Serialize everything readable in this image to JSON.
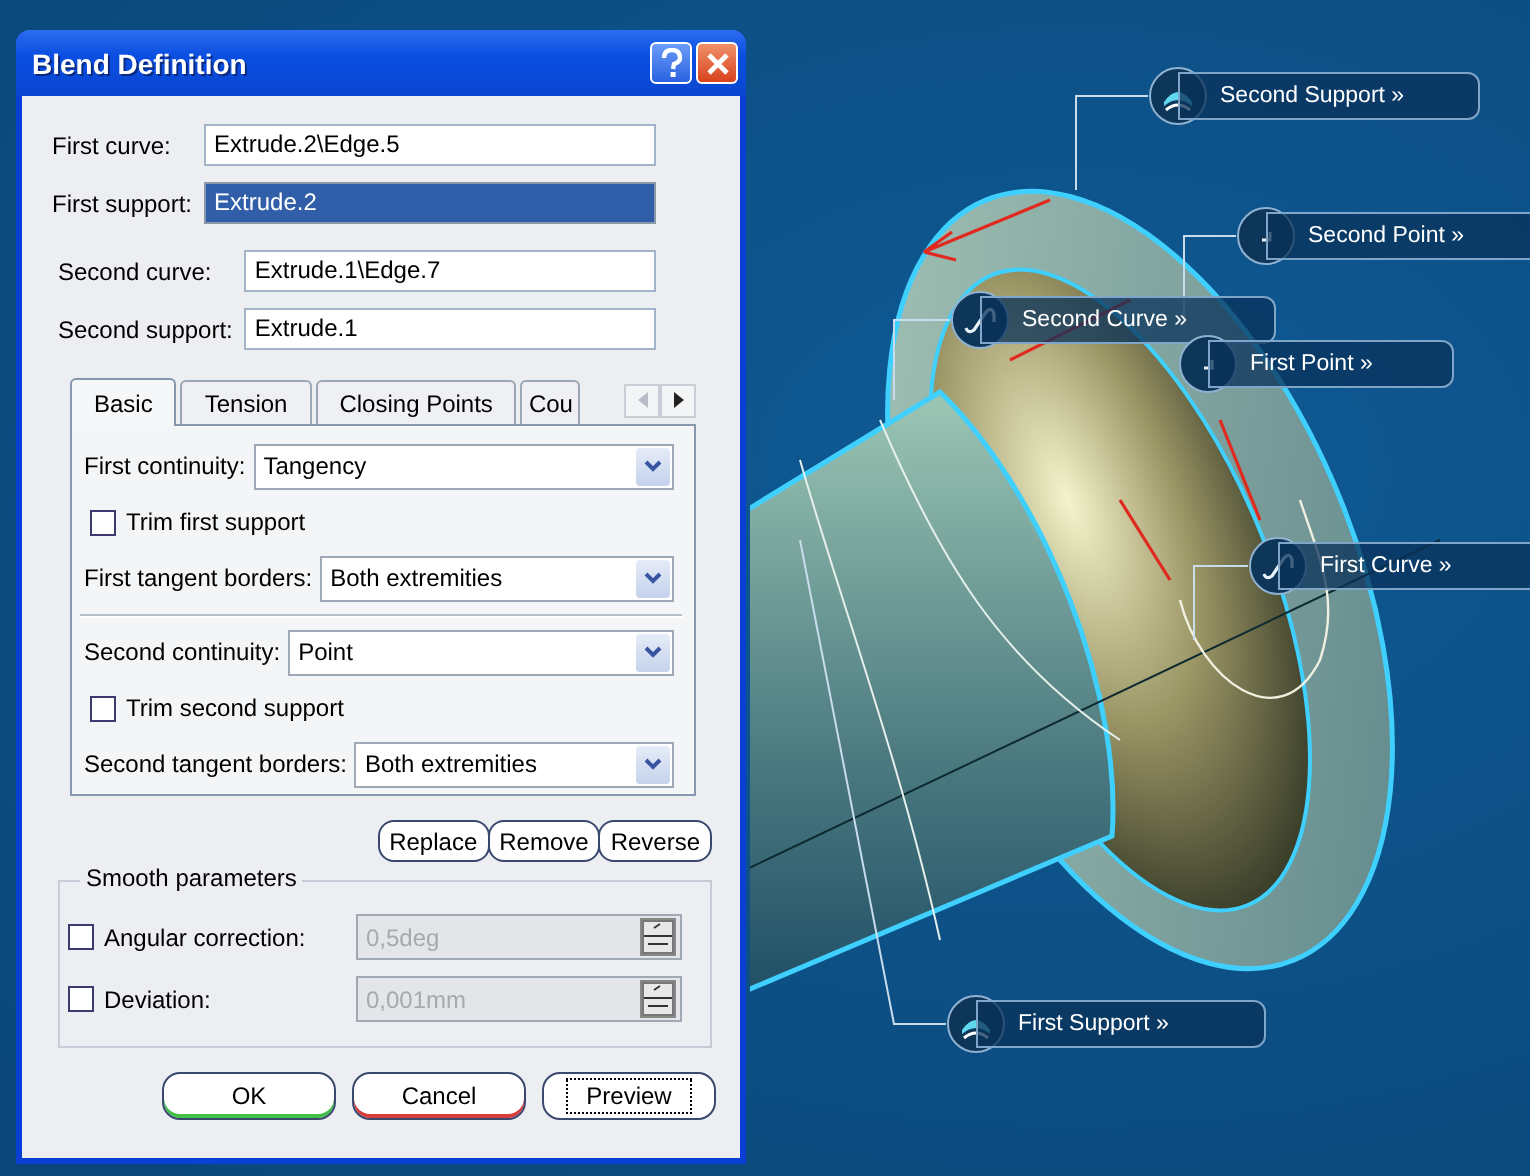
{
  "dialog": {
    "title": "Blend Definition",
    "field_groups": [
      [
        {
          "label": "First curve:",
          "value": "Extrude.2\\Edge.5",
          "selected": false
        },
        {
          "label": "First support:",
          "value": "Extrude.2",
          "selected": true
        }
      ],
      [
        {
          "label": "Second curve:",
          "value": "Extrude.1\\Edge.7",
          "selected": false
        },
        {
          "label": "Second support:",
          "value": "Extrude.1",
          "selected": false
        }
      ]
    ],
    "tabs": [
      {
        "label": "Basic",
        "selected": true
      },
      {
        "label": "Tension",
        "selected": false
      },
      {
        "label": "Closing Points",
        "selected": false
      },
      {
        "label": "Cou",
        "selected": false
      }
    ],
    "basic_groups": [
      [
        {
          "kind": "combo",
          "label": "First continuity:",
          "value": "Tangency"
        },
        {
          "kind": "checkbox",
          "label": "Trim first support",
          "checked": false
        },
        {
          "kind": "combo",
          "label": "First tangent borders:",
          "value": "Both extremities"
        }
      ],
      [
        {
          "kind": "combo",
          "label": "Second continuity:",
          "value": "Point"
        },
        {
          "kind": "checkbox",
          "label": "Trim second support",
          "checked": false
        },
        {
          "kind": "combo",
          "label": "Second tangent borders:",
          "value": "Both extremities"
        }
      ]
    ],
    "actions": [
      "Replace",
      "Remove",
      "Reverse"
    ],
    "smooth": {
      "title": "Smooth parameters",
      "rows": [
        {
          "label": "Angular correction:",
          "value": "0,5deg",
          "checked": false,
          "disabled": true
        },
        {
          "label": "Deviation:",
          "value": "0,001mm",
          "checked": false,
          "disabled": true
        }
      ]
    },
    "buttons": [
      {
        "label": "OK",
        "kind": "ok"
      },
      {
        "label": "Cancel",
        "kind": "cancel"
      },
      {
        "label": "Preview",
        "kind": "preview"
      }
    ]
  },
  "callouts": [
    {
      "label": "Second Support",
      "more": "»",
      "kind": "support"
    },
    {
      "label": "Second Point",
      "more": "»",
      "kind": "point"
    },
    {
      "label": "Second Curve",
      "more": "»",
      "kind": "curve"
    },
    {
      "label": "First Point",
      "more": "»",
      "kind": "point"
    },
    {
      "label": "First Curve",
      "more": "»",
      "kind": "curve"
    },
    {
      "label": "First Support",
      "more": "»",
      "kind": "support"
    }
  ]
}
